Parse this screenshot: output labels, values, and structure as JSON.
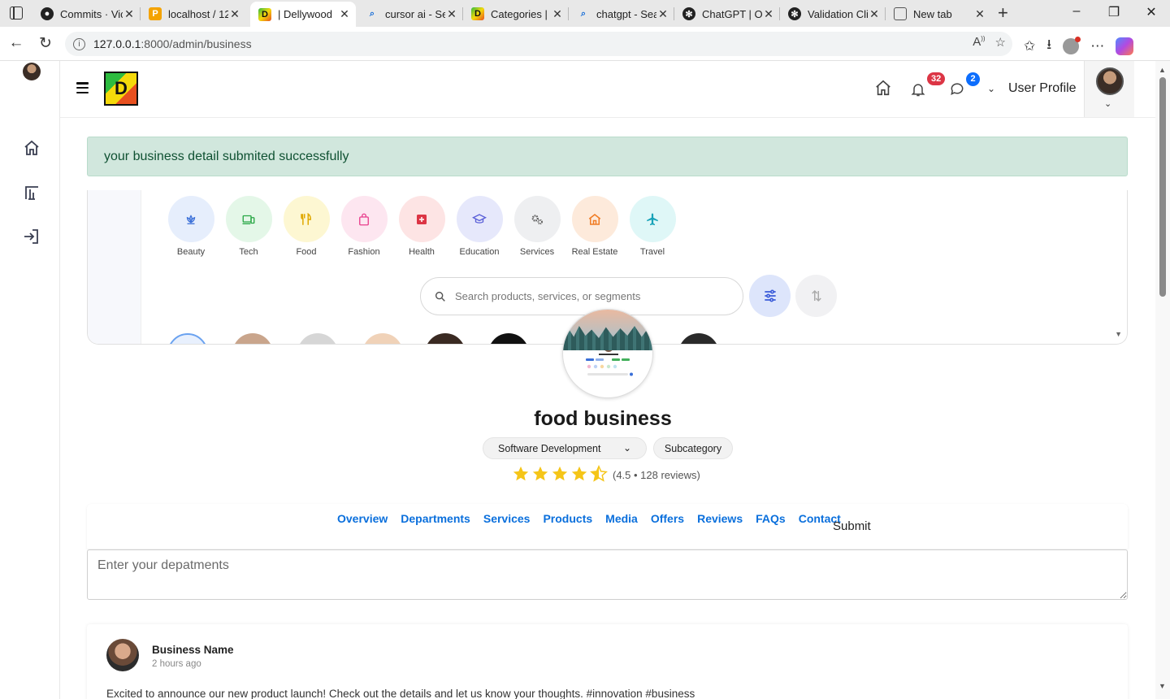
{
  "browser": {
    "tabs": [
      {
        "title": "Commits · Vic",
        "favicon": "github-icon"
      },
      {
        "title": "localhost / 12",
        "favicon": "phpmyadmin-icon"
      },
      {
        "title": "| Dellywood",
        "favicon": "dellywood-icon",
        "active": true
      },
      {
        "title": "cursor ai - Se",
        "favicon": "search-icon"
      },
      {
        "title": "Categories | D",
        "favicon": "dellywood-icon"
      },
      {
        "title": "chatgpt - Sea",
        "favicon": "search-icon"
      },
      {
        "title": "ChatGPT | Op",
        "favicon": "openai-icon"
      },
      {
        "title": "Validation Cli",
        "favicon": "openai-icon"
      },
      {
        "title": "New tab",
        "favicon": "newtab-icon"
      }
    ],
    "url_host": "127.0.0.1",
    "url_path": ":8000/admin/business"
  },
  "header": {
    "notifications_count": "32",
    "messages_count": "2",
    "user_profile_label": "User Profile"
  },
  "alert": {
    "message": "your business detail submited successfully"
  },
  "preview": {
    "categories": [
      {
        "label": "Beauty",
        "bg": "#e6eefc",
        "color": "#3a6fd8",
        "icon": "lotus-icon"
      },
      {
        "label": "Tech",
        "bg": "#e4f7e8",
        "color": "#28a745",
        "icon": "devices-icon"
      },
      {
        "label": "Food",
        "bg": "#fdf7d2",
        "color": "#e0a800",
        "icon": "utensils-icon"
      },
      {
        "label": "Fashion",
        "bg": "#fde6f0",
        "color": "#e83e8c",
        "icon": "shopping-bag-icon"
      },
      {
        "label": "Health",
        "bg": "#fde4e4",
        "color": "#dc3545",
        "icon": "medical-cross-icon"
      },
      {
        "label": "Education",
        "bg": "#e6e8fb",
        "color": "#5a5fd8",
        "icon": "graduation-cap-icon"
      },
      {
        "label": "Services",
        "bg": "#eeeff1",
        "color": "#555",
        "icon": "gears-icon"
      },
      {
        "label": "Real Estate",
        "bg": "#fdeadb",
        "color": "#f07c24",
        "icon": "house-icon"
      },
      {
        "label": "Travel",
        "bg": "#dff7f7",
        "color": "#17a2b8",
        "icon": "airplane-icon"
      }
    ],
    "search_placeholder": "Search products, services, or segments"
  },
  "business": {
    "name": "food business",
    "category_selected": "Software Development",
    "subcategory_label": "Subcategory",
    "rating": 4.5,
    "rating_text": "(4.5 • 128 reviews)"
  },
  "tabs": {
    "items": [
      "Overview",
      "Departments",
      "Services",
      "Products",
      "Media",
      "Offers",
      "Reviews",
      "FAQs",
      "Contact"
    ],
    "submit_label": "Submit"
  },
  "departments_input": {
    "placeholder": "Enter your depatments",
    "value": ""
  },
  "post": {
    "author": "Business Name",
    "time": "2 hours ago",
    "text": "Excited to announce our new product launch! Check out the details and let us know your thoughts. #innovation #business"
  }
}
